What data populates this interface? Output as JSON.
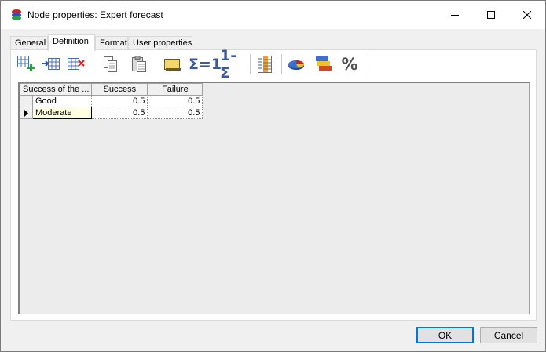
{
  "window": {
    "title": "Node properties: Expert forecast"
  },
  "tabs": [
    {
      "label": "General"
    },
    {
      "label": "Definition"
    },
    {
      "label": "Format"
    },
    {
      "label": "User properties"
    }
  ],
  "toolbar": {
    "sum_to_one_label": "Σ=1",
    "complement_label": "1-Σ",
    "percent_label": "%"
  },
  "grid": {
    "headers": [
      "Success of the ...",
      "Success",
      "Failure"
    ],
    "rows": [
      {
        "label": "Good",
        "success": "0.5",
        "failure": "0.5"
      },
      {
        "label": "Moderate",
        "success": "0.5",
        "failure": "0.5"
      }
    ]
  },
  "buttons": {
    "ok": "OK",
    "cancel": "Cancel"
  }
}
